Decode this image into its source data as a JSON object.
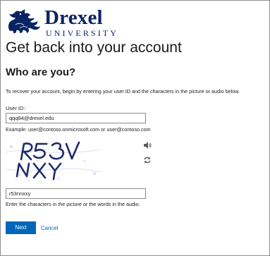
{
  "logo": {
    "name": "Drexel",
    "subtitle": "UNIVERSITY",
    "color": "#0a2463"
  },
  "page": {
    "title": "Get back into your account",
    "subtitle": "Who are you?",
    "instructions": "To recover your account, begin by entering your user ID and the characters in the picture or audio below."
  },
  "form": {
    "userid_label": "User ID:",
    "userid_value": "qqq84@drexel.edu",
    "userid_example": "Example: user@contoso.onmicrosoft.com or user@contoso.com",
    "captcha_text": "R53V NXY",
    "captcha_icons": [
      "speaker-icon",
      "refresh-icon"
    ],
    "captcha_value": "r53nnxxy",
    "captcha_help": "Enter the characters in the picture or the words in the audio."
  },
  "actions": {
    "next_label": "Next",
    "cancel_label": "Cancel",
    "accent_color": "#0067b8"
  }
}
